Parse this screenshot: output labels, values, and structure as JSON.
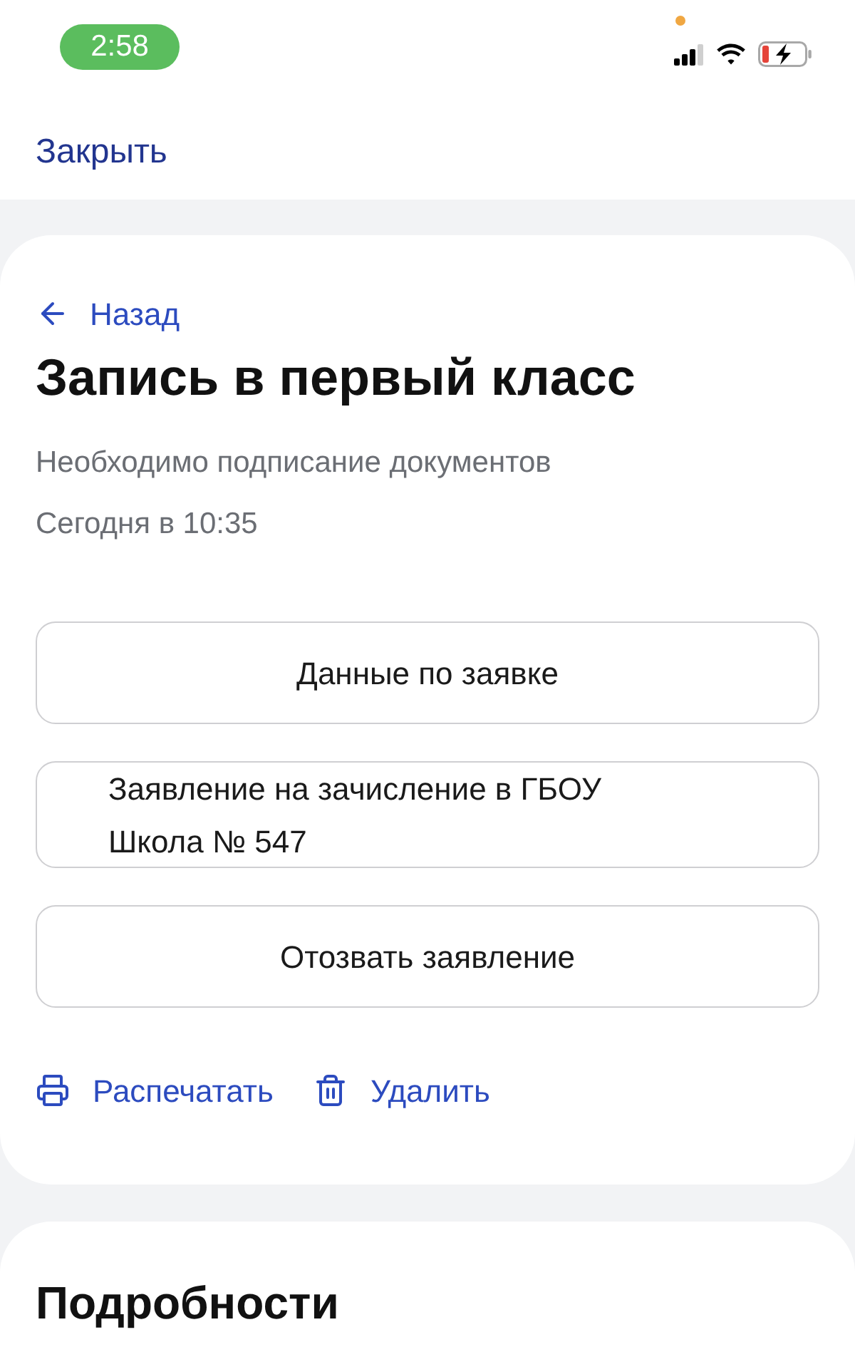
{
  "status_bar": {
    "time": "2:58"
  },
  "header": {
    "close_link": "Закрыть"
  },
  "application_card": {
    "back_link": "Назад",
    "title": "Запись в первый класс",
    "status": "Необходимо подписание документов",
    "timestamp": "Сегодня в 10:35",
    "buttons": [
      {
        "kind": "action",
        "label": "Данные по заявке"
      },
      {
        "kind": "document",
        "label": "Заявление на зачисление в ГБОУ Школа № 547"
      },
      {
        "kind": "action",
        "label": "Отозвать заявление"
      }
    ],
    "actions": [
      {
        "kind": "print",
        "label": "Распечатать"
      },
      {
        "kind": "delete",
        "label": "Удалить"
      }
    ]
  },
  "details_card": {
    "title": "Подробности"
  }
}
